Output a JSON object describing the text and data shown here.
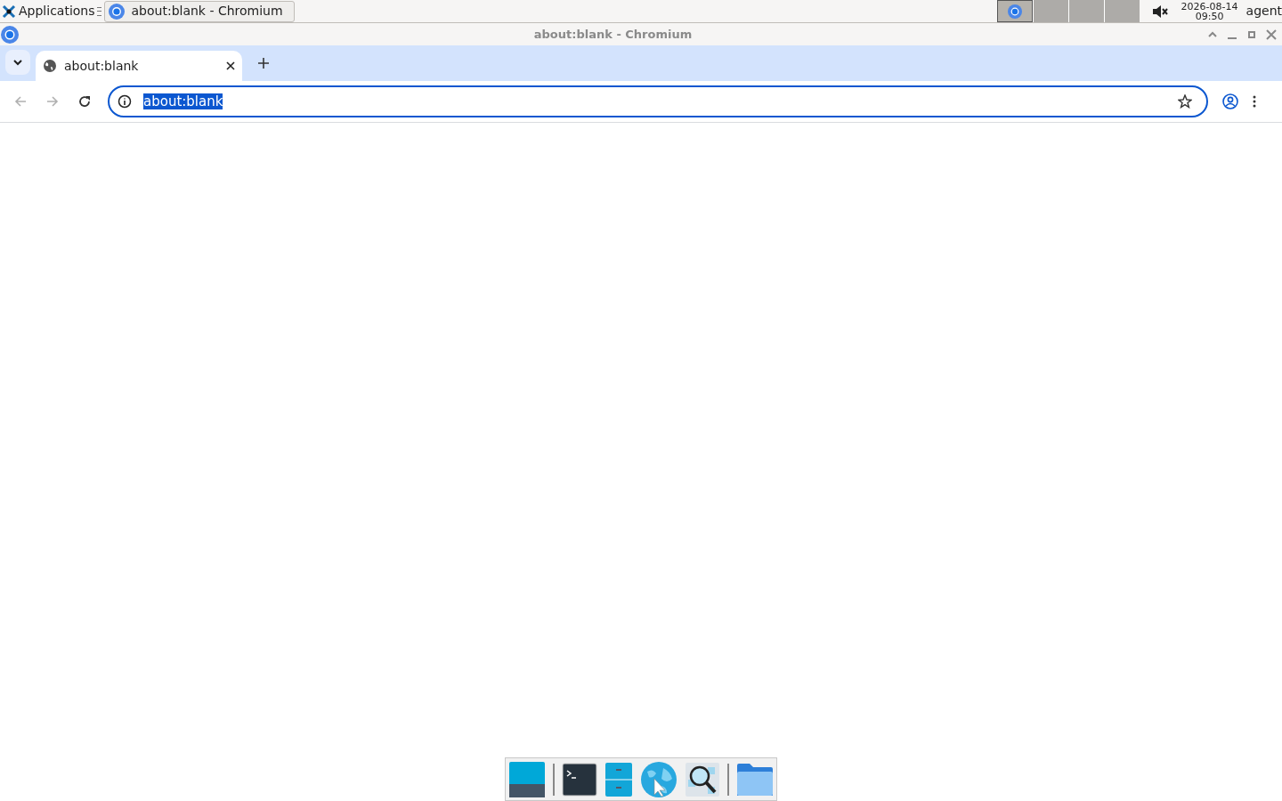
{
  "top_panel": {
    "applications_label": "Applications",
    "taskbar_windows": [
      {
        "title": "about:blank - Chromium",
        "selected": true
      }
    ],
    "workspaces": [
      {
        "selected": true
      },
      {
        "selected": false
      },
      {
        "selected": false
      },
      {
        "selected": false
      }
    ],
    "clock": {
      "date": "2026-08-14",
      "time": "09:50"
    },
    "user": "agent"
  },
  "window": {
    "title": "about:blank - Chromium"
  },
  "tabs": [
    {
      "title": "about:blank",
      "selected": true
    }
  ],
  "address_bar": {
    "value": "about:blank",
    "text_selected": true
  }
}
